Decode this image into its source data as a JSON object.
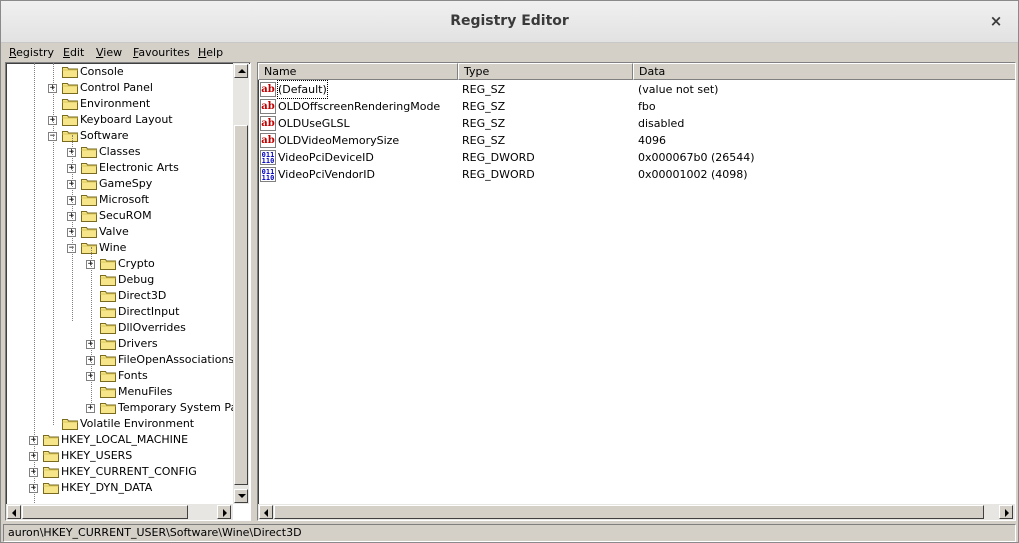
{
  "window": {
    "title": "Registry Editor",
    "close_glyph": "×"
  },
  "menu": [
    {
      "label": "Registry",
      "accel": "R"
    },
    {
      "label": "Edit",
      "accel": "E"
    },
    {
      "label": "View",
      "accel": "V"
    },
    {
      "label": "Favourites",
      "accel": "F"
    },
    {
      "label": "Help",
      "accel": "H"
    }
  ],
  "tree": {
    "items": [
      {
        "label": "Console",
        "level": 2,
        "expander": "none"
      },
      {
        "label": "Control Panel",
        "level": 2,
        "expander": "+"
      },
      {
        "label": "Environment",
        "level": 2,
        "expander": "none"
      },
      {
        "label": "Keyboard Layout",
        "level": 2,
        "expander": "+"
      },
      {
        "label": "Software",
        "level": 2,
        "expander": "-"
      },
      {
        "label": "Classes",
        "level": 3,
        "expander": "+"
      },
      {
        "label": "Electronic Arts",
        "level": 3,
        "expander": "+"
      },
      {
        "label": "GameSpy",
        "level": 3,
        "expander": "+"
      },
      {
        "label": "Microsoft",
        "level": 3,
        "expander": "+"
      },
      {
        "label": "SecuROM",
        "level": 3,
        "expander": "+"
      },
      {
        "label": "Valve",
        "level": 3,
        "expander": "+"
      },
      {
        "label": "Wine",
        "level": 3,
        "expander": "-"
      },
      {
        "label": "Crypto",
        "level": 4,
        "expander": "+"
      },
      {
        "label": "Debug",
        "level": 4,
        "expander": "none"
      },
      {
        "label": "Direct3D",
        "level": 4,
        "expander": "none",
        "selected": true
      },
      {
        "label": "DirectInput",
        "level": 4,
        "expander": "none"
      },
      {
        "label": "DllOverrides",
        "level": 4,
        "expander": "none"
      },
      {
        "label": "Drivers",
        "level": 4,
        "expander": "+"
      },
      {
        "label": "FileOpenAssociations",
        "level": 4,
        "expander": "+"
      },
      {
        "label": "Fonts",
        "level": 4,
        "expander": "+"
      },
      {
        "label": "MenuFiles",
        "level": 4,
        "expander": "none"
      },
      {
        "label": "Temporary System Para",
        "level": 4,
        "expander": "+"
      },
      {
        "label": "Volatile Environment",
        "level": 2,
        "expander": "none"
      },
      {
        "label": "HKEY_LOCAL_MACHINE",
        "level": 1,
        "expander": "+"
      },
      {
        "label": "HKEY_USERS",
        "level": 1,
        "expander": "+"
      },
      {
        "label": "HKEY_CURRENT_CONFIG",
        "level": 1,
        "expander": "+"
      },
      {
        "label": "HKEY_DYN_DATA",
        "level": 1,
        "expander": "+"
      }
    ]
  },
  "list": {
    "columns": [
      "Name",
      "Type",
      "Data"
    ],
    "rows": [
      {
        "icon": "string-value-icon",
        "glyph": "ab",
        "name": "(Default)",
        "type": "REG_SZ",
        "data": "(value not set)"
      },
      {
        "icon": "string-value-icon",
        "glyph": "ab",
        "name": "OLDOffscreenRenderingMode",
        "type": "REG_SZ",
        "data": "fbo"
      },
      {
        "icon": "string-value-icon",
        "glyph": "ab",
        "name": "OLDUseGLSL",
        "type": "REG_SZ",
        "data": "disabled"
      },
      {
        "icon": "string-value-icon",
        "glyph": "ab",
        "name": "OLDVideoMemorySize",
        "type": "REG_SZ",
        "data": "4096"
      },
      {
        "icon": "binary-value-icon",
        "glyph": "011 110",
        "name": "VideoPciDeviceID",
        "type": "REG_DWORD",
        "data": "0x000067b0 (26544)"
      },
      {
        "icon": "binary-value-icon",
        "glyph": "011 110",
        "name": "VideoPciVendorID",
        "type": "REG_DWORD",
        "data": "0x00001002 (4098)"
      }
    ]
  },
  "status": {
    "path": "auron\\HKEY_CURRENT_USER\\Software\\Wine\\Direct3D"
  },
  "colors": {
    "window_bg": "#d4d0c8",
    "pane_bg": "#ffffff",
    "string_icon": "#c00000",
    "binary_icon": "#0000c0"
  }
}
